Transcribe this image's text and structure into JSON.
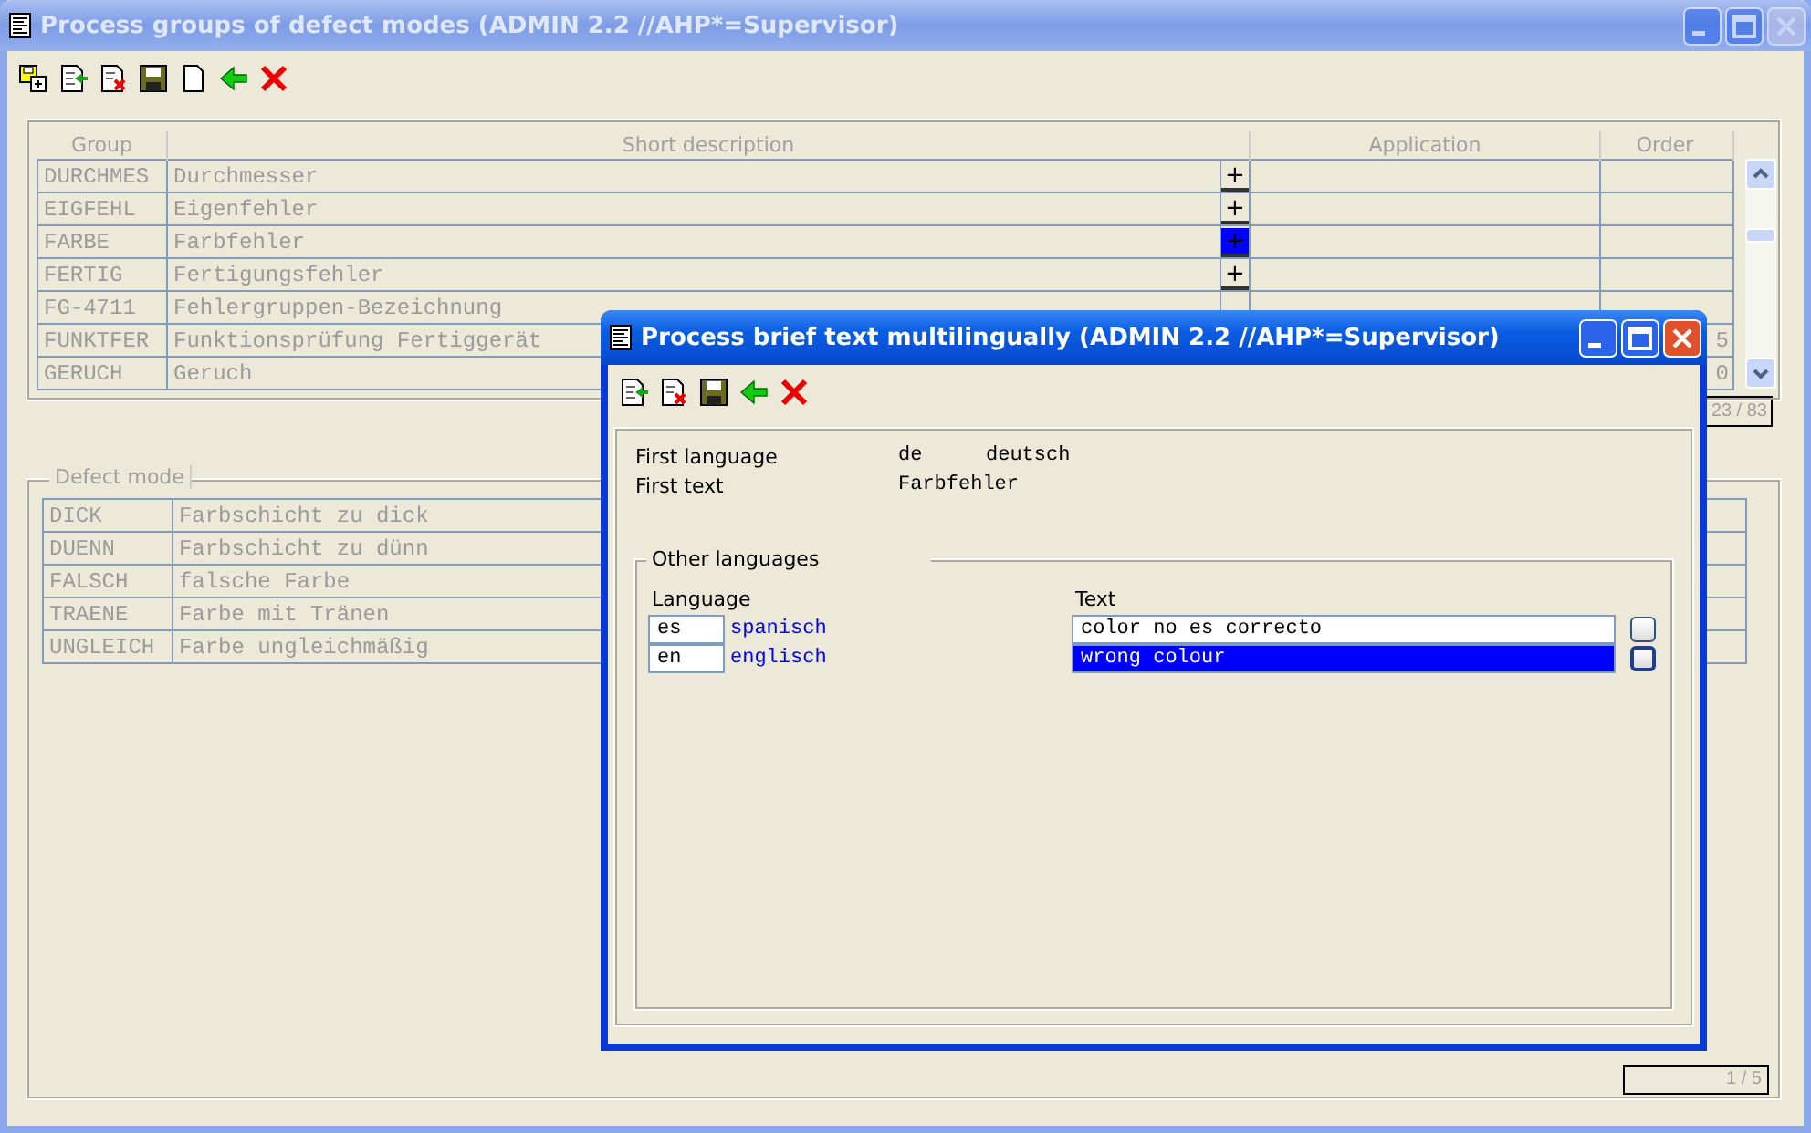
{
  "main_window": {
    "title": "Process groups of defect modes (ADMIN 2.2 //AHP*=Supervisor)",
    "active": false,
    "toolbar": [
      {
        "kind": "copy"
      },
      {
        "kind": "import"
      },
      {
        "kind": "delete"
      },
      {
        "kind": "save"
      },
      {
        "kind": "new"
      },
      {
        "kind": "back"
      },
      {
        "kind": "cancel"
      }
    ],
    "group_table": {
      "columns": [
        "Group",
        "Short description",
        "Application",
        "Order"
      ],
      "rows": [
        {
          "group": "DURCHMES",
          "description": "Durchmesser",
          "expand_button": {
            "label": "+",
            "selected": false
          }
        },
        {
          "group": "EIGFEHL",
          "description": "Eigenfehler",
          "expand_button": {
            "label": "+",
            "selected": false
          }
        },
        {
          "group": "FARBE",
          "description": "Farbfehler",
          "expand_button": {
            "label": "+",
            "selected": true
          }
        },
        {
          "group": "FERTIG",
          "description": "Fertigungsfehler",
          "expand_button": {
            "label": "+",
            "selected": false
          }
        },
        {
          "group": "FG-4711",
          "description": "Fehlergruppen-Bezeichnung"
        },
        {
          "group": "FUNKTFER",
          "description": "Funktionsprüfung Fertiggerät",
          "order": "5"
        },
        {
          "group": "GERUCH",
          "description": "Geruch",
          "order": "0"
        }
      ],
      "counter": "23 / 83"
    },
    "defect_mode": {
      "title": "Defect mode",
      "rows": [
        {
          "code": "DICK",
          "description": "Farbschicht zu dick"
        },
        {
          "code": "DUENN",
          "description": "Farbschicht zu dünn"
        },
        {
          "code": "FALSCH",
          "description": "falsche Farbe"
        },
        {
          "code": "TRAENE",
          "description": "Farbe mit Tränen"
        },
        {
          "code": "UNGLEICH",
          "description": "Farbe ungleichmäßig"
        }
      ],
      "counter": "1 / 5"
    }
  },
  "dialog": {
    "title": "Process brief text multilingually (ADMIN 2.2 //AHP*=Supervisor)",
    "active": true,
    "toolbar": [
      {
        "kind": "import"
      },
      {
        "kind": "delete"
      },
      {
        "kind": "save"
      },
      {
        "kind": "back"
      },
      {
        "kind": "cancel"
      }
    ],
    "first_language": {
      "label": "First language",
      "code": "de",
      "name": "deutsch"
    },
    "first_text": {
      "label": "First text",
      "value": "Farbfehler"
    },
    "other_languages": {
      "title": "Other languages",
      "columns": [
        "Language",
        "Text"
      ],
      "rows": [
        {
          "code": "es",
          "name": "spanisch",
          "text": "color no es correcto",
          "selected": false
        },
        {
          "code": "en",
          "name": "englisch",
          "text": "wrong colour",
          "selected": true
        }
      ]
    }
  }
}
